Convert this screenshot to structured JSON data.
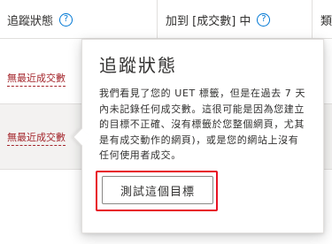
{
  "table": {
    "columns": [
      {
        "label": "追蹤狀態",
        "help_icon": "question-circle-icon"
      },
      {
        "label": "加到 [成交數] 中",
        "help_icon": "question-circle-icon"
      },
      {
        "label": "類"
      }
    ],
    "rows": [
      {
        "status": "無最近成交數"
      },
      {
        "status": "無最近成交數"
      }
    ]
  },
  "popover": {
    "title": "追蹤狀態",
    "body": "我們看見了您的 UET 標籤，但是在過去 7 天內未記錄任何成交數。這很可能是因為您建立的目標不正確、沒有標籤於您整個網頁，尤其是有成交動作的網頁)，或是您的網站上沒有任何使用者成交。",
    "button_label": "測試這個目標"
  },
  "colors": {
    "accent": "#0078d4",
    "status_link": "#a4262c",
    "highlight": "#e81123"
  }
}
